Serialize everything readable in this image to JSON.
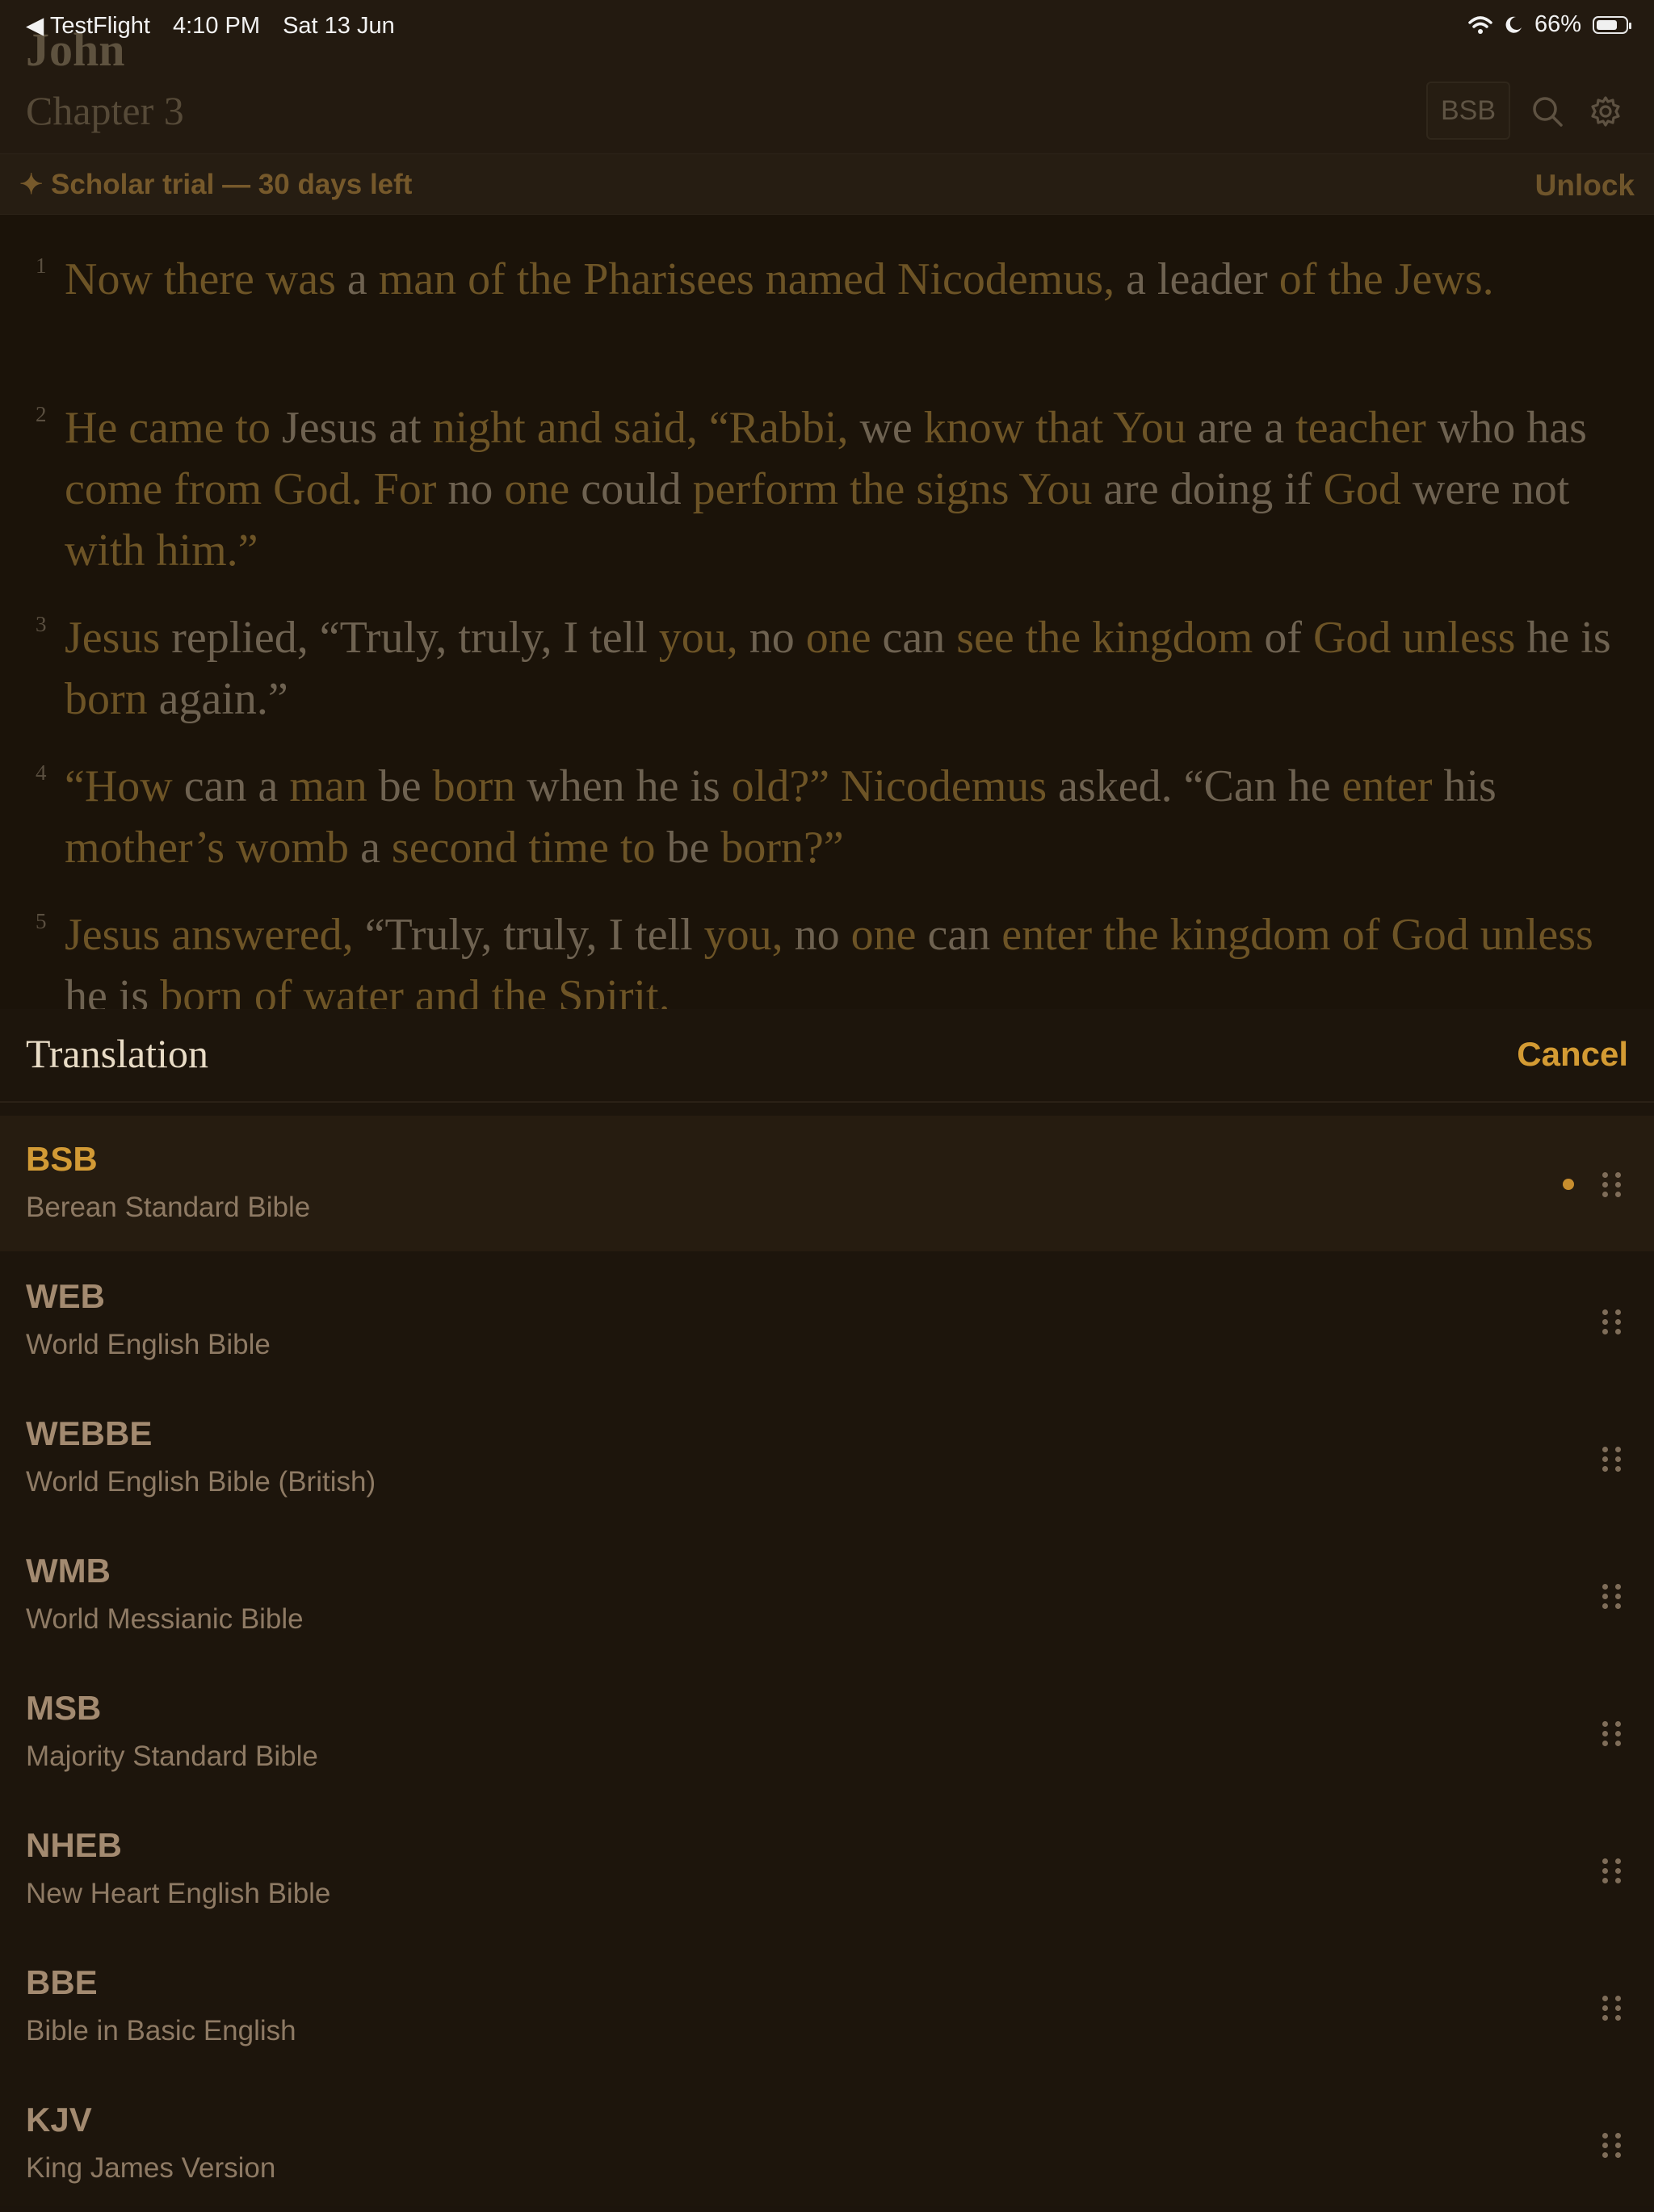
{
  "status_bar": {
    "back_app": "◀ TestFlight",
    "time": "4:10 PM",
    "date": "Sat 13 Jun",
    "battery": "66%"
  },
  "reader": {
    "book": "John",
    "chapter": "Chapter 3",
    "translation_chip": "BSB"
  },
  "trial": {
    "text": "✦ Scholar trial — 30 days left",
    "unlock": "Unlock"
  },
  "verses": [
    {
      "num": "1",
      "segments": [
        {
          "t": "Now there was",
          "h": true
        },
        {
          "t": " a ",
          "h": false
        },
        {
          "t": "man of the Pharisees named Nicodemus,",
          "h": true
        },
        {
          "t": " a leader ",
          "h": false
        },
        {
          "t": "of the Jews.",
          "h": true
        }
      ]
    },
    {
      "num": "2",
      "segments": [
        {
          "t": "He came to",
          "h": true
        },
        {
          "t": " Jesus at ",
          "h": false
        },
        {
          "t": "night and said, “Rabbi,",
          "h": true
        },
        {
          "t": " we ",
          "h": false
        },
        {
          "t": "know that You",
          "h": true
        },
        {
          "t": " are a ",
          "h": false
        },
        {
          "t": "teacher",
          "h": true
        },
        {
          "t": " who has ",
          "h": false
        },
        {
          "t": "come from God. For",
          "h": true
        },
        {
          "t": " no ",
          "h": false
        },
        {
          "t": "one",
          "h": true
        },
        {
          "t": " could ",
          "h": false
        },
        {
          "t": "perform the signs You",
          "h": true
        },
        {
          "t": " are doing if ",
          "h": false
        },
        {
          "t": "God",
          "h": true
        },
        {
          "t": " were not ",
          "h": false
        },
        {
          "t": "with him.”",
          "h": true
        }
      ]
    },
    {
      "num": "3",
      "segments": [
        {
          "t": "Jesus",
          "h": true
        },
        {
          "t": " replied, “Truly, truly, I tell ",
          "h": false
        },
        {
          "t": "you,",
          "h": true
        },
        {
          "t": " no ",
          "h": false
        },
        {
          "t": "one",
          "h": true
        },
        {
          "t": " can ",
          "h": false
        },
        {
          "t": "see the kingdom",
          "h": true
        },
        {
          "t": " of ",
          "h": false
        },
        {
          "t": "God unless",
          "h": true
        },
        {
          "t": " he is ",
          "h": false
        },
        {
          "t": "born",
          "h": true
        },
        {
          "t": " again.”",
          "h": false
        }
      ]
    },
    {
      "num": "4",
      "segments": [
        {
          "t": "“How",
          "h": true
        },
        {
          "t": " can a ",
          "h": false
        },
        {
          "t": "man",
          "h": true
        },
        {
          "t": " be ",
          "h": false
        },
        {
          "t": "born",
          "h": true
        },
        {
          "t": " when he is ",
          "h": false
        },
        {
          "t": "old?” Nicodemus",
          "h": true
        },
        {
          "t": " asked. “Can he ",
          "h": false
        },
        {
          "t": "enter",
          "h": true
        },
        {
          "t": " his ",
          "h": false
        },
        {
          "t": "mother’s womb",
          "h": true
        },
        {
          "t": " a ",
          "h": false
        },
        {
          "t": "second time to",
          "h": true
        },
        {
          "t": " be ",
          "h": false
        },
        {
          "t": "born?”",
          "h": true
        }
      ]
    },
    {
      "num": "5",
      "segments": [
        {
          "t": "Jesus answered,",
          "h": true
        },
        {
          "t": " “Truly, truly, I tell ",
          "h": false
        },
        {
          "t": "you,",
          "h": true
        },
        {
          "t": " no ",
          "h": false
        },
        {
          "t": "one",
          "h": true
        },
        {
          "t": " can ",
          "h": false
        },
        {
          "t": "enter the kingdom of God unless",
          "h": true
        },
        {
          "t": " he is ",
          "h": false
        },
        {
          "t": "born of water and the Spirit.",
          "h": true
        }
      ]
    }
  ],
  "sheet": {
    "title": "Translation",
    "cancel": "Cancel",
    "translations": [
      {
        "code": "BSB",
        "name": "Berean Standard Bible",
        "selected": true
      },
      {
        "code": "WEB",
        "name": "World English Bible",
        "selected": false
      },
      {
        "code": "WEBBE",
        "name": "World English Bible (British)",
        "selected": false
      },
      {
        "code": "WMB",
        "name": "World Messianic Bible",
        "selected": false
      },
      {
        "code": "MSB",
        "name": "Majority Standard Bible",
        "selected": false
      },
      {
        "code": "NHEB",
        "name": "New Heart English Bible",
        "selected": false
      },
      {
        "code": "BBE",
        "name": "Bible in Basic English",
        "selected": false
      },
      {
        "code": "KJV",
        "name": "King James Version",
        "selected": false
      }
    ]
  },
  "icons": {
    "header": [
      "search-icon",
      "gear-icon"
    ],
    "status": [
      "wifi-icon",
      "moon-icon",
      "battery-icon"
    ],
    "rows": [
      "selected-dot-icon",
      "drag-handle-icon"
    ]
  },
  "colors": {
    "accent": "#d49b33",
    "background": "#1c140c",
    "highlight_text": "#6d5426"
  }
}
